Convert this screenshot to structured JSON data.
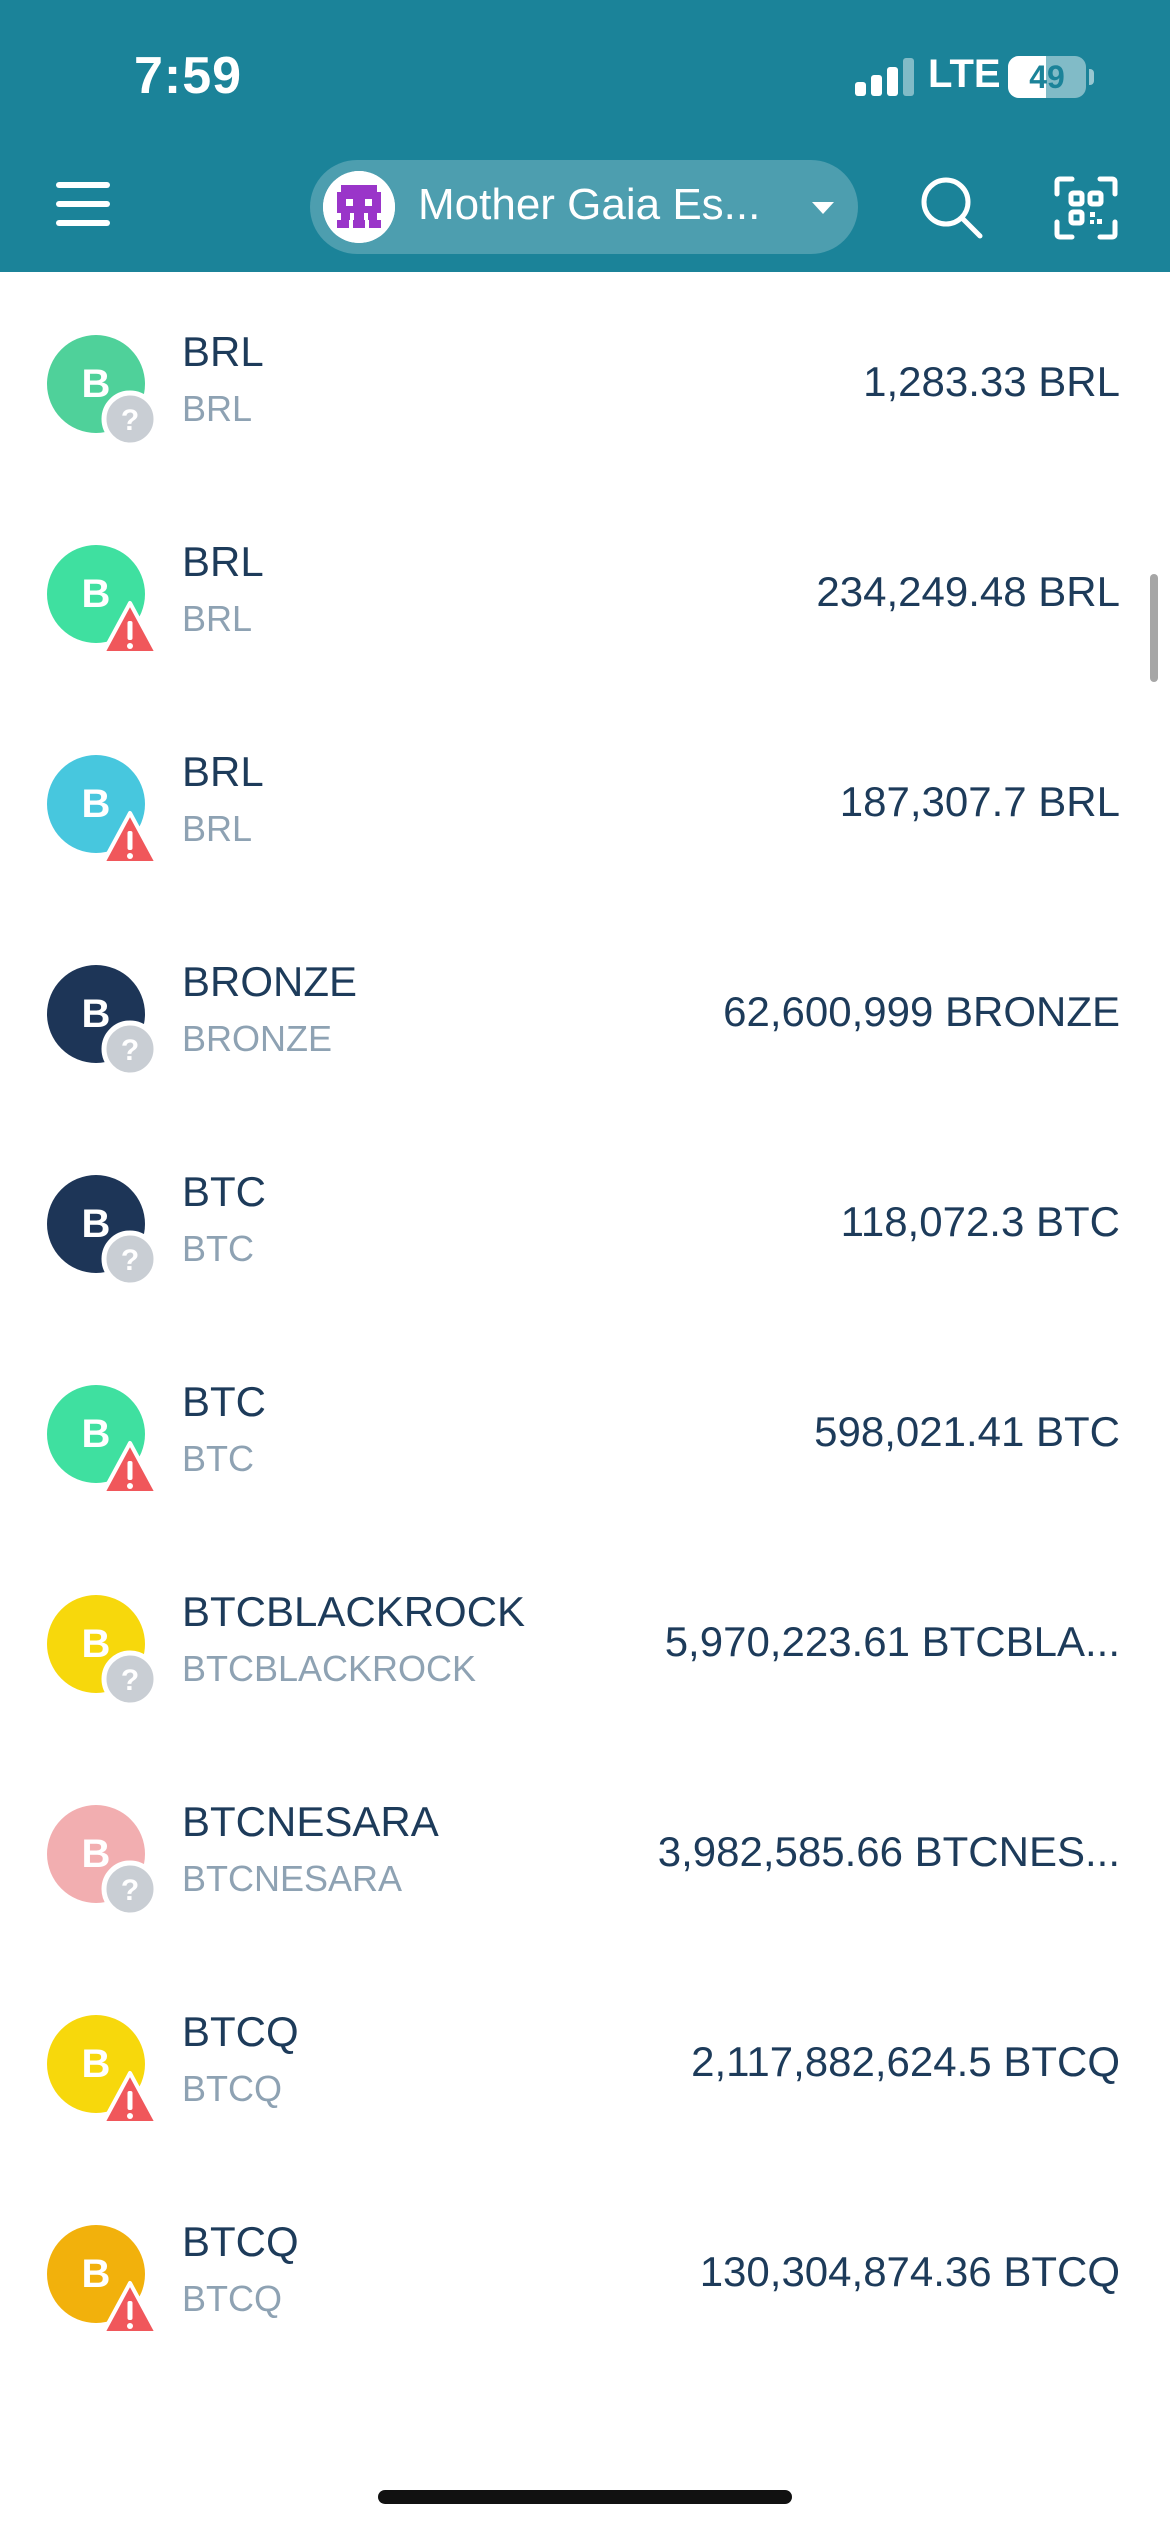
{
  "status_bar": {
    "time": "7:59",
    "network": "LTE",
    "battery_level": "49",
    "signal_bars_active": 3,
    "signal_bars_total": 4
  },
  "header": {
    "wallet_name": "Mother Gaia Es...",
    "icons": {
      "menu": "hamburger-menu-icon",
      "caret": "chevron-down-icon",
      "search": "search-icon",
      "scan": "qr-scan-icon"
    }
  },
  "colors": {
    "header_bg": "#1b8399",
    "text_primary": "#1d3b5a",
    "text_secondary": "#8ea2b3",
    "warning": "#f0575b",
    "unknown_badge": "#c9ced4"
  },
  "assets": [
    {
      "initial": "B",
      "name": "BRL",
      "symbol": "BRL",
      "balance": "1,283.33 BRL",
      "avatar_color": "#4fd19a",
      "badge": "unknown"
    },
    {
      "initial": "B",
      "name": "BRL",
      "symbol": "BRL",
      "balance": "234,249.48 BRL",
      "avatar_color": "#3fe0a0",
      "badge": "warning"
    },
    {
      "initial": "B",
      "name": "BRL",
      "symbol": "BRL",
      "balance": "187,307.7 BRL",
      "avatar_color": "#47c7de",
      "badge": "warning"
    },
    {
      "initial": "B",
      "name": "BRONZE",
      "symbol": "BRONZE",
      "balance": "62,600,999 BRONZE",
      "avatar_color": "#1d3557",
      "badge": "unknown"
    },
    {
      "initial": "B",
      "name": "BTC",
      "symbol": "BTC",
      "balance": "118,072.3 BTC",
      "avatar_color": "#1d3557",
      "badge": "unknown"
    },
    {
      "initial": "B",
      "name": "BTC",
      "symbol": "BTC",
      "balance": "598,021.41 BTC",
      "avatar_color": "#3fe0a0",
      "badge": "warning"
    },
    {
      "initial": "B",
      "name": "BTCBLACKROCK",
      "symbol": "BTCBLACKROCK",
      "balance": "5,970,223.61 BTCBLA...",
      "avatar_color": "#f7d80c",
      "badge": "unknown"
    },
    {
      "initial": "B",
      "name": "BTCNESARA",
      "symbol": "BTCNESARA",
      "balance": "3,982,585.66 BTCNES...",
      "avatar_color": "#f2aeb0",
      "badge": "unknown"
    },
    {
      "initial": "B",
      "name": "BTCQ",
      "symbol": "BTCQ",
      "balance": "2,117,882,624.5 BTCQ",
      "avatar_color": "#f7d80c",
      "badge": "warning"
    },
    {
      "initial": "B",
      "name": "BTCQ",
      "symbol": "BTCQ",
      "balance": "130,304,874.36 BTCQ",
      "avatar_color": "#f2b10c",
      "badge": "warning"
    }
  ]
}
